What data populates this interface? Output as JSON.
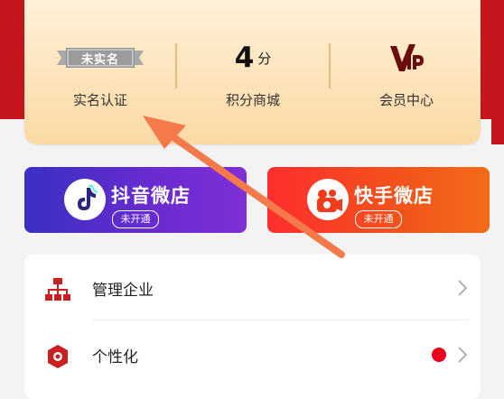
{
  "stats": {
    "realname": {
      "badge": "未实名",
      "label": "实名认证"
    },
    "points": {
      "value": "4",
      "unit": "分",
      "label": "积分商城"
    },
    "vip": {
      "label": "会员中心"
    }
  },
  "shops": [
    {
      "title": "抖音微店",
      "status": "未开通"
    },
    {
      "title": "快手微店",
      "status": "未开通"
    }
  ],
  "menu": [
    {
      "label": "管理企业"
    },
    {
      "label": "个性化"
    }
  ],
  "colors": {
    "primary_red": "#c4161c",
    "card_gold": "#fbd9a4",
    "douyin": "#4b2fc0",
    "kuaishou": "#f2401c",
    "arrow": "#f47a4c"
  }
}
